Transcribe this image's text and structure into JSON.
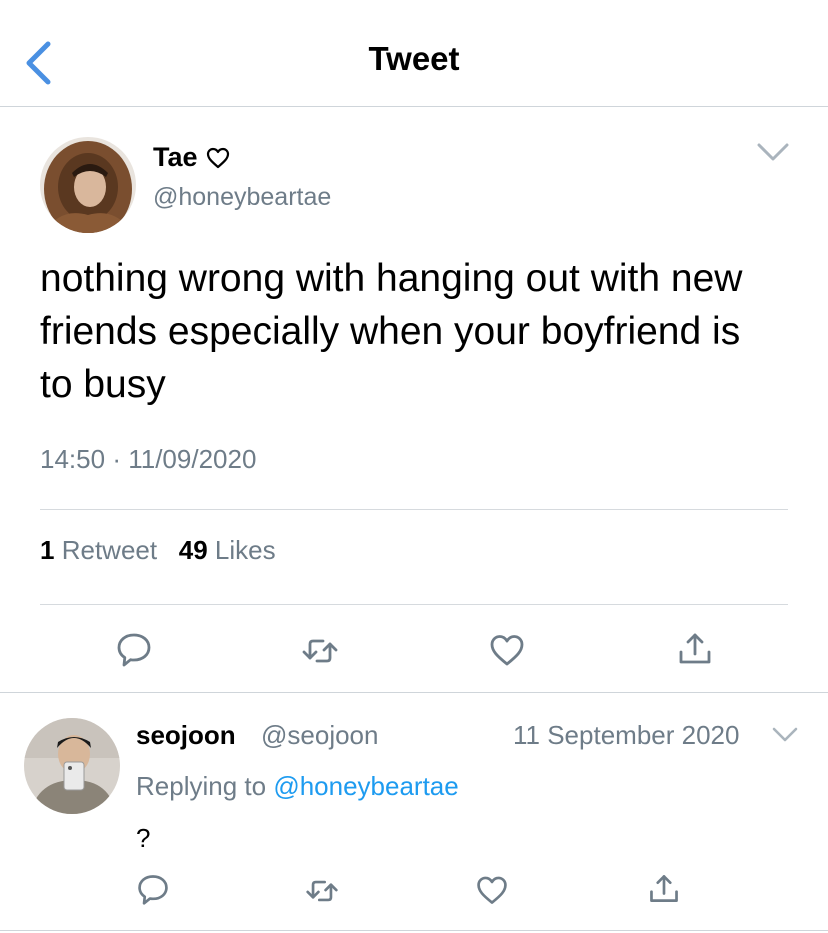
{
  "header": {
    "title": "Tweet",
    "back_icon": "chevron-left-icon"
  },
  "tweet": {
    "author_name": "Tae",
    "name_icon": "heart-outline-icon",
    "handle": "@honeybeartae",
    "text": "nothing wrong with hanging out with new friends especially when your boyfriend is to busy",
    "time": "14:50",
    "dot": "·",
    "date": "11/09/2020",
    "retweet_count": "1",
    "retweet_label": "Retweet",
    "like_count": "49",
    "like_label": "Likes",
    "actions": [
      "reply-icon",
      "retweet-icon",
      "like-icon",
      "share-icon"
    ]
  },
  "reply": {
    "author_name": "seojoon",
    "handle": "@seojoon",
    "date": "11 September 2020",
    "replying_prefix": "Replying to",
    "replying_to": "@honeybeartae",
    "text": "?"
  },
  "colors": {
    "accent": "#1d9bf0",
    "back_arrow": "#4a90e2",
    "secondary_text": "#6e7c88",
    "divider": "#cfd5da"
  }
}
